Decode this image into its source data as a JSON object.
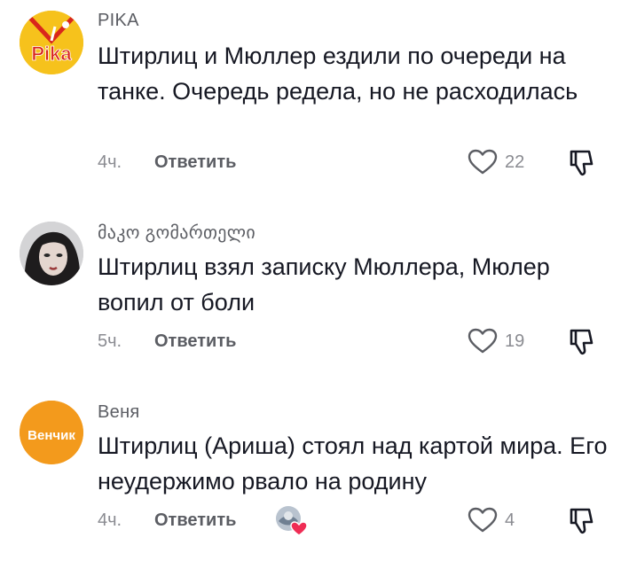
{
  "comments": [
    {
      "username": "PIKA",
      "avatar_text": "Pika",
      "text": "Штирлиц и Мюллер ездили по очереди на танке. Очередь редела, но не расходилась",
      "time": "4ч.",
      "reply_label": "Ответить",
      "likes": "22"
    },
    {
      "username": "მაკო გომართელი",
      "text": "Штирлиц взял записку Мюллера, Мюлер вопил от боли",
      "time": "5ч.",
      "reply_label": "Ответить",
      "likes": "19"
    },
    {
      "username": "Веня",
      "avatar_text": "Венчик",
      "text": "Штирлиц (Ариша) стоял над картой мира. Его неудержимо рвало на родину",
      "time": "4ч.",
      "reply_label": "Ответить",
      "likes": "4"
    }
  ],
  "icons": {
    "like": "heart-outline-icon",
    "dislike": "thumbs-down-icon",
    "creator_like": "creator-liked-badge-icon"
  },
  "colors": {
    "pika_yellow": "#f6c21c",
    "pika_red": "#d9261c",
    "venchik_orange": "#f39a1c",
    "creator_heart": "#ef2d55"
  }
}
